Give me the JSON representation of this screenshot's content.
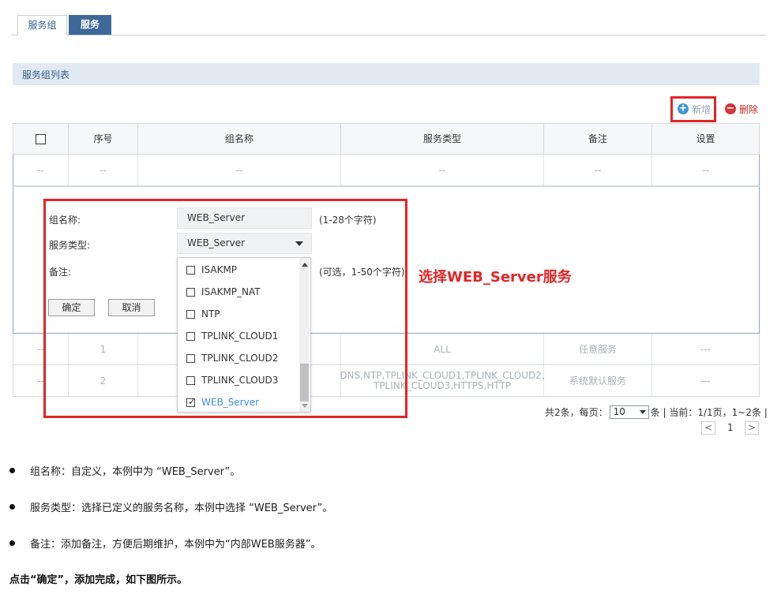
{
  "tabs": [
    {
      "label": "服务组",
      "active": true
    },
    {
      "label": "服务",
      "active": false
    }
  ],
  "section_title": "服务组列表",
  "actions": {
    "add_label": "新增",
    "delete_label": "删除"
  },
  "table": {
    "headers": [
      "",
      "序号",
      "组名称",
      "服务类型",
      "备注",
      "设置"
    ],
    "placeholder_row": [
      "--",
      "--",
      "--",
      "--",
      "--",
      "--"
    ],
    "rows": [
      {
        "check": "--",
        "index": "1",
        "name": "",
        "service_type": "ALL",
        "note": "任意服务",
        "settings": "---"
      },
      {
        "check": "--",
        "index": "2",
        "name": "",
        "service_type": "DNS,NTP,TPLINK_CLOUD1,TPLINK_CLOUD2,\nTPLINK_CLOUD3,HTTPS,HTTP",
        "note": "系统默认服务",
        "settings": "---"
      }
    ]
  },
  "form": {
    "name_label": "组名称:",
    "name_value": "WEB_Server",
    "name_hint": "(1-28个字符)",
    "type_label": "服务类型:",
    "type_value": "WEB_Server",
    "note_label": "备注:",
    "note_hint": "(可选，1-50个字符)",
    "ok_label": "确定",
    "cancel_label": "取消"
  },
  "dropdown_options": [
    {
      "label": "ISAKMP",
      "checked": false
    },
    {
      "label": "ISAKMP_NAT",
      "checked": false
    },
    {
      "label": "NTP",
      "checked": false
    },
    {
      "label": "TPLINK_CLOUD1",
      "checked": false
    },
    {
      "label": "TPLINK_CLOUD2",
      "checked": false
    },
    {
      "label": "TPLINK_CLOUD3",
      "checked": false
    },
    {
      "label": "WEB_Server",
      "checked": true
    }
  ],
  "annotation": "选择WEB_Server服务",
  "pager": {
    "prefix": "共2条，每页：",
    "per_page": "10",
    "suffix": "条 | 当前：1/1页，1~2条 |",
    "current_page": "1",
    "prev": "<",
    "next": ">"
  },
  "bullets": [
    "组名称：自定义，本例中为 “WEB_Server”。",
    "服务类型：选择已定义的服务名称，本例中选择 “WEB_Server”。",
    "备注：添加备注，方便后期维护，本例中为“内部WEB服务器”。"
  ],
  "final_note": "点击“确定”，添加完成，如下图所示。",
  "colors": {
    "accent": "#3d6899",
    "annotation_red": "#e32526",
    "selected_option": "#3a8fd6"
  }
}
